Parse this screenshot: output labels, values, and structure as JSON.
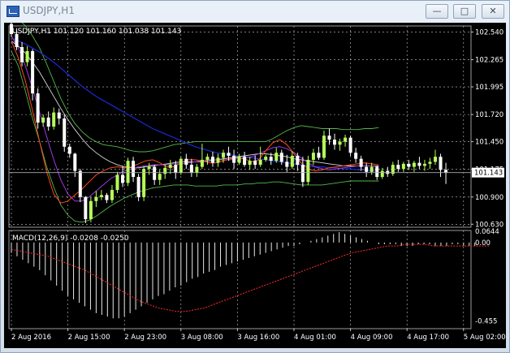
{
  "window": {
    "title": "USDJPY,H1",
    "controls": {
      "minimize": "—",
      "maximize": "□",
      "close": "✕"
    }
  },
  "colors": {
    "background": "#000000",
    "grid": "#c8c8c8",
    "candle_up": "#b6ff58",
    "candle_down": "#ffffff",
    "bollinger": "#55b84a",
    "ma_slow": "#1a2ad6",
    "ma_mid": "#d8d8d8",
    "ma_fast_1": "#9a3be0",
    "ma_fast_2": "#ff4a1a",
    "macd_hist": "#e8e8e8",
    "macd_signal": "#ff2a2a"
  },
  "chart_data": {
    "type": "candlestick",
    "header": "USDJPY,H1  101.120 101.160 101.038 101.143",
    "ylim": [
      100.6,
      102.6
    ],
    "y_ticks": [
      "102.540",
      "102.265",
      "101.995",
      "101.720",
      "101.450",
      "101.175",
      "100.900",
      "100.630"
    ],
    "y_tick_values": [
      102.54,
      102.265,
      101.995,
      101.72,
      101.45,
      101.175,
      100.9,
      100.63
    ],
    "current_price": "101.143",
    "current_price_value": 101.143,
    "x_ticks": [
      "2 Aug 2016",
      "2 Aug 15:00",
      "2 Aug 23:00",
      "3 Aug 08:00",
      "3 Aug 16:00",
      "4 Aug 01:00",
      "4 Aug 09:00",
      "4 Aug 17:00",
      "5 Aug 02:00"
    ],
    "x_tick_index": [
      0,
      16,
      32,
      48,
      64,
      80,
      96,
      112,
      128
    ],
    "grid": true,
    "candles": [
      [
        102.62,
        102.66,
        102.49,
        102.52
      ],
      [
        102.52,
        102.56,
        102.36,
        102.39
      ],
      [
        102.39,
        102.44,
        102.2,
        102.24
      ],
      [
        102.24,
        102.4,
        102.2,
        102.35
      ],
      [
        102.35,
        102.37,
        101.86,
        101.93
      ],
      [
        101.93,
        101.98,
        101.58,
        101.64
      ],
      [
        101.64,
        101.72,
        101.6,
        101.69
      ],
      [
        101.69,
        101.75,
        101.56,
        101.6
      ],
      [
        101.6,
        101.79,
        101.57,
        101.74
      ],
      [
        101.74,
        101.78,
        101.62,
        101.68
      ],
      [
        101.68,
        101.72,
        101.35,
        101.4
      ],
      [
        101.4,
        101.43,
        101.29,
        101.33
      ],
      [
        101.33,
        101.34,
        101.1,
        101.16
      ],
      [
        101.16,
        101.18,
        100.85,
        100.9
      ],
      [
        100.9,
        100.91,
        100.64,
        100.68
      ],
      [
        100.68,
        100.9,
        100.65,
        100.86
      ],
      [
        100.86,
        100.96,
        100.8,
        100.9
      ],
      [
        100.9,
        100.97,
        100.87,
        100.92
      ],
      [
        100.92,
        100.94,
        100.84,
        100.87
      ],
      [
        100.87,
        101.02,
        100.84,
        100.97
      ],
      [
        100.97,
        101.15,
        100.94,
        101.12
      ],
      [
        101.12,
        101.21,
        101.0,
        101.04
      ],
      [
        101.04,
        101.29,
        101.01,
        101.26
      ],
      [
        101.26,
        101.3,
        101.05,
        101.1
      ],
      [
        101.1,
        101.13,
        100.86,
        100.9
      ],
      [
        100.9,
        101.21,
        100.86,
        101.18
      ],
      [
        101.18,
        101.24,
        101.12,
        101.2
      ],
      [
        101.2,
        101.22,
        101.02,
        101.07
      ],
      [
        101.07,
        101.17,
        101.02,
        101.13
      ],
      [
        101.13,
        101.22,
        101.08,
        101.19
      ],
      [
        101.19,
        101.27,
        101.13,
        101.22
      ],
      [
        101.22,
        101.26,
        101.08,
        101.14
      ],
      [
        101.14,
        101.3,
        101.12,
        101.28
      ],
      [
        101.28,
        101.33,
        101.18,
        101.22
      ],
      [
        101.22,
        101.28,
        101.1,
        101.14
      ],
      [
        101.14,
        101.23,
        101.1,
        101.2
      ],
      [
        101.2,
        101.43,
        101.18,
        101.27
      ],
      [
        101.27,
        101.33,
        101.22,
        101.3
      ],
      [
        101.3,
        101.35,
        101.2,
        101.24
      ],
      [
        101.24,
        101.33,
        101.2,
        101.29
      ],
      [
        101.29,
        101.37,
        101.24,
        101.34
      ],
      [
        101.34,
        101.4,
        101.26,
        101.31
      ],
      [
        101.31,
        101.37,
        101.18,
        101.24
      ],
      [
        101.24,
        101.33,
        101.22,
        101.3
      ],
      [
        101.3,
        101.35,
        101.2,
        101.22
      ],
      [
        101.22,
        101.3,
        101.17,
        101.26
      ],
      [
        101.26,
        101.31,
        101.18,
        101.22
      ],
      [
        101.22,
        101.4,
        101.2,
        101.27
      ],
      [
        101.27,
        101.32,
        101.25,
        101.3
      ],
      [
        101.3,
        101.34,
        101.22,
        101.26
      ],
      [
        101.26,
        101.39,
        101.24,
        101.34
      ],
      [
        101.34,
        101.37,
        101.22,
        101.25
      ],
      [
        101.25,
        101.32,
        101.15,
        101.2
      ],
      [
        101.2,
        101.36,
        101.18,
        101.31
      ],
      [
        101.31,
        101.34,
        101.16,
        101.22
      ],
      [
        101.22,
        101.3,
        101.0,
        101.05
      ],
      [
        101.05,
        101.31,
        101.02,
        101.27
      ],
      [
        101.27,
        101.38,
        101.22,
        101.34
      ],
      [
        101.34,
        101.4,
        101.27,
        101.29
      ],
      [
        101.29,
        101.56,
        101.27,
        101.51
      ],
      [
        101.51,
        101.58,
        101.42,
        101.47
      ],
      [
        101.47,
        101.53,
        101.37,
        101.42
      ],
      [
        101.42,
        101.48,
        101.36,
        101.45
      ],
      [
        101.45,
        101.52,
        101.4,
        101.49
      ],
      [
        101.49,
        101.51,
        101.31,
        101.34
      ],
      [
        101.34,
        101.39,
        101.24,
        101.28
      ],
      [
        101.28,
        101.31,
        101.16,
        101.2
      ],
      [
        101.2,
        101.24,
        101.1,
        101.15
      ],
      [
        101.15,
        101.24,
        101.12,
        101.2
      ],
      [
        101.2,
        101.21,
        101.07,
        101.1
      ],
      [
        101.1,
        101.19,
        101.08,
        101.16
      ],
      [
        101.16,
        101.2,
        101.1,
        101.13
      ],
      [
        101.13,
        101.25,
        101.11,
        101.22
      ],
      [
        101.22,
        101.27,
        101.15,
        101.18
      ],
      [
        101.18,
        101.25,
        101.15,
        101.23
      ],
      [
        101.23,
        101.27,
        101.17,
        101.2
      ],
      [
        101.2,
        101.26,
        101.15,
        101.24
      ],
      [
        101.24,
        101.3,
        101.18,
        101.21
      ],
      [
        101.21,
        101.27,
        101.16,
        101.23
      ],
      [
        101.23,
        101.29,
        101.18,
        101.25
      ],
      [
        101.25,
        101.37,
        101.22,
        101.3
      ],
      [
        101.3,
        101.33,
        101.1,
        101.17
      ],
      [
        101.17,
        101.24,
        101.03,
        101.14
      ]
    ],
    "indicators": {
      "bollinger_upper": [
        102.71,
        102.67,
        102.6,
        102.5,
        102.38,
        102.22,
        102.05,
        101.88,
        101.74,
        101.63,
        101.55,
        101.49,
        101.45,
        101.42,
        101.41,
        101.4,
        101.38,
        101.36,
        101.35,
        101.35,
        101.36,
        101.38,
        101.4,
        101.42,
        101.43,
        101.44,
        101.45,
        101.45,
        101.45,
        101.45,
        101.45,
        101.45,
        101.45,
        101.45,
        101.45,
        101.45,
        101.45,
        101.48,
        101.52,
        101.56,
        101.59,
        101.61,
        101.6,
        101.59,
        101.58,
        101.58,
        101.58,
        101.57,
        101.57,
        101.57,
        101.58,
        101.58,
        101.59
      ],
      "bollinger_lower": [
        102.35,
        102.2,
        101.95,
        101.68,
        101.45,
        101.2,
        101.0,
        100.82,
        100.72,
        100.66,
        100.65,
        100.67,
        100.71,
        100.76,
        100.81,
        100.85,
        100.89,
        100.92,
        100.95,
        100.97,
        100.99,
        101.0,
        101.01,
        101.02,
        101.02,
        101.02,
        101.01,
        101.01,
        101.01,
        101.01,
        101.02,
        101.02,
        101.02,
        101.03,
        101.03,
        101.04,
        101.04,
        101.05,
        101.05,
        101.04,
        101.03,
        101.02,
        101.02,
        101.02,
        101.02,
        101.03,
        101.04,
        101.05,
        101.06,
        101.06,
        101.06,
        101.06,
        101.06
      ],
      "ma_slow": [
        102.48,
        102.45,
        102.42,
        102.38,
        102.34,
        102.29,
        102.24,
        102.18,
        102.12,
        102.06,
        102.0,
        101.95,
        101.9,
        101.86,
        101.82,
        101.78,
        101.74,
        101.7,
        101.66,
        101.62,
        101.58,
        101.55,
        101.52,
        101.49,
        101.46,
        101.43,
        101.4,
        101.38,
        101.36,
        101.34,
        101.33,
        101.32,
        101.31,
        101.3,
        101.29,
        101.28,
        101.27,
        101.26,
        101.25,
        101.24,
        101.23,
        101.22,
        101.21,
        101.2,
        101.2,
        101.19,
        101.19,
        101.18,
        101.18,
        101.17,
        101.17,
        101.16,
        101.16
      ],
      "ma_mid": [
        102.45,
        102.4,
        102.33,
        102.24,
        102.14,
        102.02,
        101.9,
        101.78,
        101.67,
        101.57,
        101.48,
        101.4,
        101.34,
        101.29,
        101.25,
        101.22,
        101.2,
        101.19,
        101.19,
        101.2,
        101.21,
        101.22,
        101.23,
        101.24,
        101.25,
        101.25,
        101.25,
        101.25,
        101.26,
        101.27,
        101.28,
        101.29,
        101.3,
        101.31,
        101.32,
        101.33,
        101.33,
        101.32,
        101.31,
        101.3,
        101.28,
        101.27,
        101.26,
        101.25,
        101.24,
        101.23,
        101.22,
        101.21,
        101.21,
        101.21,
        101.21,
        101.21,
        101.21
      ],
      "ma_fast_1": [
        102.5,
        102.38,
        102.2,
        101.98,
        101.74,
        101.5,
        101.27,
        101.07,
        100.93,
        100.86,
        100.86,
        100.9,
        100.96,
        101.02,
        101.08,
        101.12,
        101.16,
        101.18,
        101.2,
        101.21,
        101.22,
        101.22,
        101.22,
        101.23,
        101.23,
        101.24,
        101.25,
        101.26,
        101.27,
        101.27,
        101.27,
        101.27,
        101.28,
        101.29,
        101.3,
        101.33,
        101.36,
        101.39,
        101.4,
        101.38,
        101.34,
        101.29,
        101.24,
        101.2,
        101.18,
        101.17,
        101.18,
        101.19,
        101.2,
        101.21,
        101.21,
        101.21,
        101.2
      ],
      "ma_fast_2": [
        102.45,
        102.28,
        102.05,
        101.76,
        101.45,
        101.15,
        100.93,
        100.84,
        100.86,
        100.92,
        100.98,
        101.05,
        101.12,
        101.16,
        101.19,
        101.2,
        101.19,
        101.2,
        101.23,
        101.26,
        101.27,
        101.24,
        101.2,
        101.2,
        101.24,
        101.27,
        101.27,
        101.26,
        101.24,
        101.24,
        101.26,
        101.28,
        101.29,
        101.28,
        101.25,
        101.27,
        101.36,
        101.44,
        101.47,
        101.42,
        101.33,
        101.24,
        101.18,
        101.16,
        101.17,
        101.19,
        101.2,
        101.21,
        101.22,
        101.23,
        101.24,
        101.23,
        101.22
      ]
    },
    "macd": {
      "label": "MACD(12,26,9) -0.0208 -0.0250",
      "ylim": [
        -0.5,
        0.07
      ],
      "y_ticks": [
        "0.0644",
        "0.00",
        "-0.455"
      ],
      "y_tick_values": [
        0.0644,
        0.0,
        -0.455
      ],
      "histogram": [
        -0.06,
        -0.08,
        -0.1,
        -0.12,
        -0.14,
        -0.16,
        -0.19,
        -0.22,
        -0.25,
        -0.28,
        -0.31,
        -0.33,
        -0.35,
        -0.37,
        -0.39,
        -0.41,
        -0.42,
        -0.43,
        -0.44,
        -0.44,
        -0.43,
        -0.41,
        -0.39,
        -0.37,
        -0.35,
        -0.33,
        -0.31,
        -0.3,
        -0.28,
        -0.26,
        -0.25,
        -0.23,
        -0.21,
        -0.2,
        -0.18,
        -0.17,
        -0.16,
        -0.14,
        -0.13,
        -0.12,
        -0.11,
        -0.1,
        -0.09,
        -0.08,
        -0.07,
        -0.06,
        -0.05,
        -0.04,
        -0.03,
        -0.02,
        -0.02,
        -0.01,
        0.0,
        0.01,
        0.02,
        0.03,
        0.04,
        0.05,
        0.06,
        0.05,
        0.04,
        0.03,
        0.02,
        0.01,
        0.0,
        -0.01,
        -0.01,
        -0.01,
        -0.01,
        -0.02,
        -0.02,
        -0.02,
        -0.01,
        -0.01,
        -0.01,
        -0.02,
        -0.02,
        -0.02,
        -0.01,
        -0.01,
        -0.02,
        -0.02,
        -0.02
      ],
      "signal": [
        -0.04,
        -0.05,
        -0.06,
        -0.07,
        -0.08,
        -0.1,
        -0.12,
        -0.14,
        -0.16,
        -0.19,
        -0.22,
        -0.25,
        -0.28,
        -0.31,
        -0.34,
        -0.36,
        -0.38,
        -0.39,
        -0.4,
        -0.4,
        -0.39,
        -0.38,
        -0.36,
        -0.34,
        -0.32,
        -0.3,
        -0.28,
        -0.26,
        -0.24,
        -0.22,
        -0.2,
        -0.18,
        -0.16,
        -0.14,
        -0.12,
        -0.1,
        -0.08,
        -0.06,
        -0.05,
        -0.04,
        -0.03,
        -0.02,
        -0.02,
        -0.01,
        -0.01,
        -0.01,
        -0.02,
        -0.02,
        -0.02,
        -0.02,
        -0.02,
        -0.02,
        -0.02
      ]
    }
  }
}
